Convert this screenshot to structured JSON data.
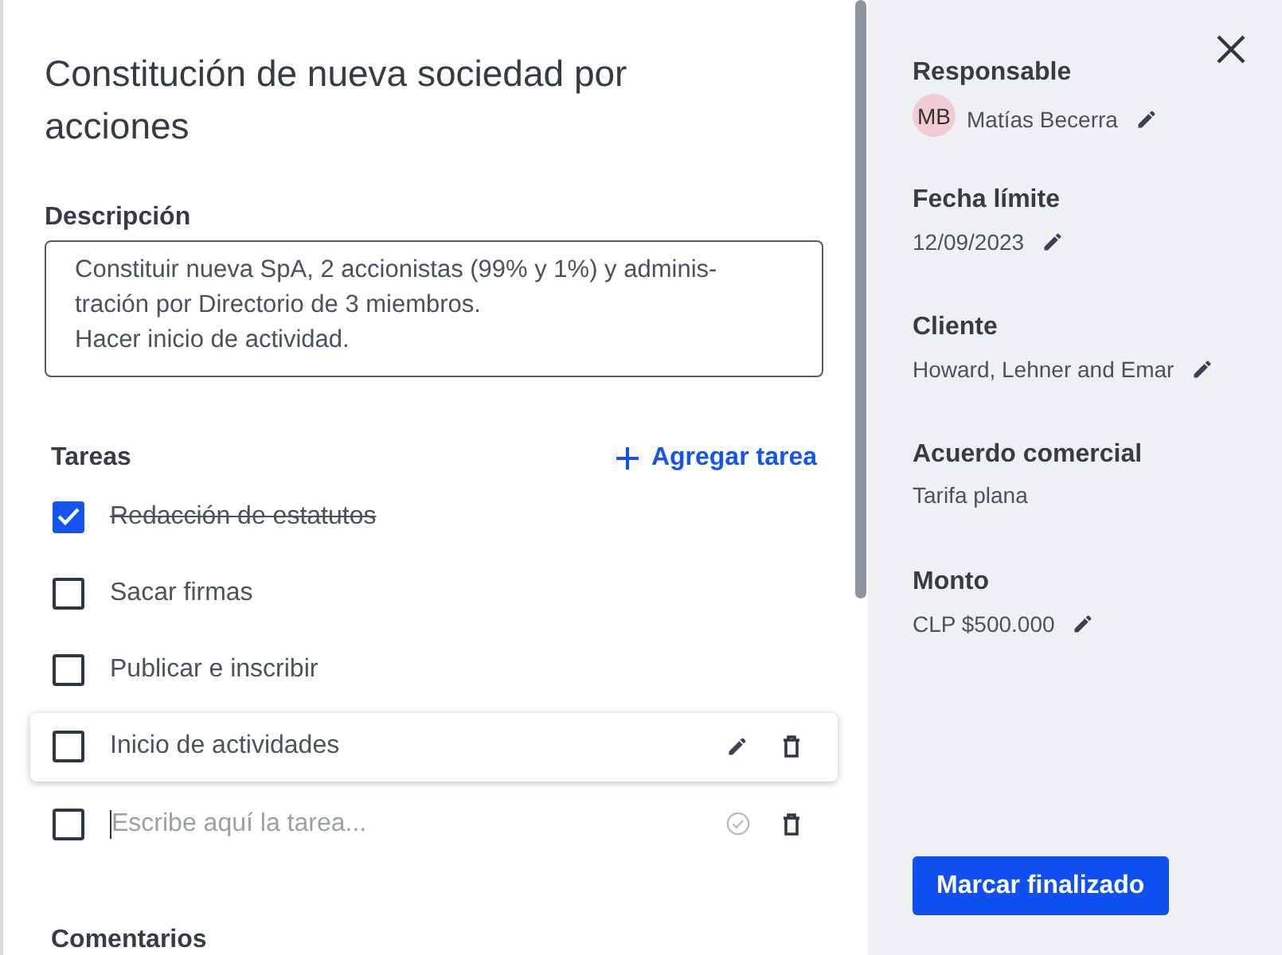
{
  "task": {
    "title": "Constitución de nueva sociedad por acciones",
    "description": {
      "label": "Descripción",
      "value": "Constituir nueva SpA, 2 accionistas (99% y 1%) y adminis-\ntración por Directorio de 3 miembros.\nHacer inicio de actividad."
    },
    "tasks_section": {
      "label": "Tareas",
      "add_button": "Agregar tarea",
      "items": [
        {
          "kind": "task",
          "label": "Redacción de estatutos",
          "checked": true,
          "hovered": false
        },
        {
          "kind": "task",
          "label": "Sacar firmas",
          "checked": false,
          "hovered": false
        },
        {
          "kind": "task",
          "label": "Publicar e inscribir",
          "checked": false,
          "hovered": false
        },
        {
          "kind": "task",
          "label": "Inicio de actividades",
          "checked": false,
          "hovered": true
        },
        {
          "kind": "new",
          "placeholder": "Escribe aquí la tarea...",
          "checked": false
        }
      ]
    },
    "comments": {
      "label": "Comentarios"
    }
  },
  "details": {
    "fields": [
      {
        "label": "Responsable",
        "value": "Matías Becerra",
        "avatar": "MB",
        "editable": true
      },
      {
        "label": "Fecha límite",
        "value": "12/09/2023",
        "editable": true
      },
      {
        "label": "Cliente",
        "value": "Howard, Lehner and Emar",
        "editable": true
      },
      {
        "label": "Acuerdo comercial",
        "value": "Tarifa plana",
        "editable": false
      },
      {
        "label": "Monto",
        "value": "CLP $500.000",
        "editable": true
      }
    ],
    "finish_button": "Marcar finalizado"
  }
}
